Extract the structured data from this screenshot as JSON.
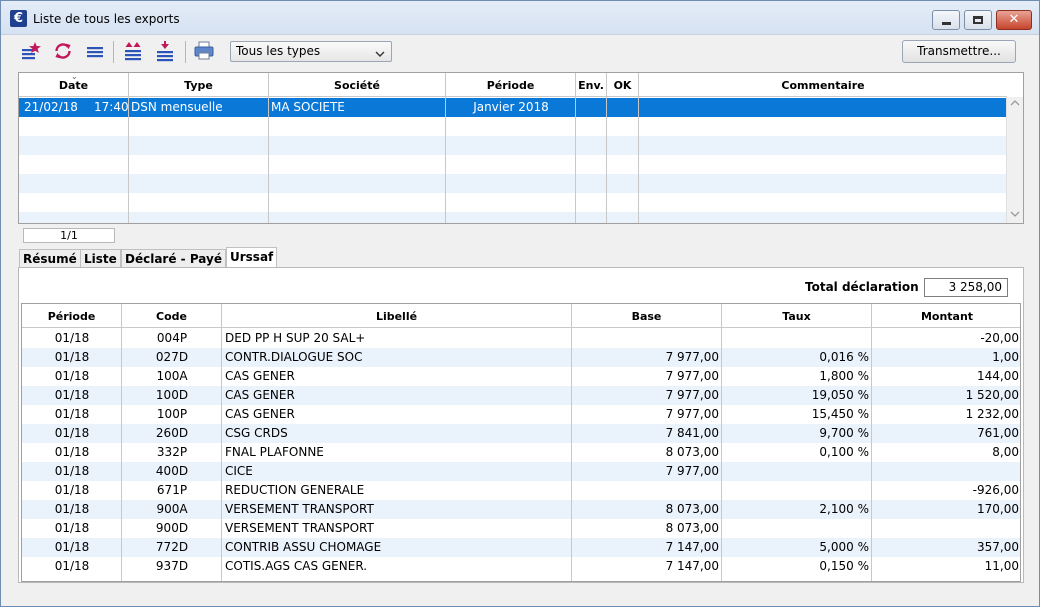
{
  "window": {
    "title": "Liste de tous les exports",
    "close_glyph": "✕"
  },
  "toolbar": {
    "icons": [
      "new-star-list-icon",
      "refresh-icon",
      "list-icon",
      "import-up-icon",
      "export-down-icon",
      "printer-icon"
    ],
    "type_filter": {
      "selected": "Tous les types"
    },
    "transmit_label": "Transmettre..."
  },
  "exports_grid": {
    "columns": [
      "Date",
      "Type",
      "Société",
      "Période",
      "Env.",
      "OK",
      "Commentaire"
    ],
    "rows": [
      {
        "date": "21/02/18",
        "time": "17:40",
        "type": "DSN mensuelle",
        "societe": "MA SOCIETE",
        "periode": "Janvier 2018",
        "env": "",
        "ok": "",
        "commentaire": ""
      }
    ],
    "pager": "1/1"
  },
  "tabs": [
    "Résumé",
    "Liste",
    "Déclaré - Payé",
    "Urssaf"
  ],
  "active_tab": "Urssaf",
  "urssaf": {
    "total_label": "Total déclaration",
    "total_value": "3 258,00",
    "columns": [
      "Période",
      "Code",
      "Libellé",
      "Base",
      "Taux",
      "Montant"
    ],
    "rows": [
      {
        "periode": "01/18",
        "code": "004P",
        "libelle": "DED PP H SUP 20 SAL+",
        "base": "",
        "taux": "",
        "montant": "-20,00"
      },
      {
        "periode": "01/18",
        "code": "027D",
        "libelle": "CONTR.DIALOGUE SOC",
        "base": "7 977,00",
        "taux": "0,016 %",
        "montant": "1,00"
      },
      {
        "periode": "01/18",
        "code": "100A",
        "libelle": "CAS GENER",
        "base": "7 977,00",
        "taux": "1,800 %",
        "montant": "144,00"
      },
      {
        "periode": "01/18",
        "code": "100D",
        "libelle": "CAS GENER",
        "base": "7 977,00",
        "taux": "19,050 %",
        "montant": "1 520,00"
      },
      {
        "periode": "01/18",
        "code": "100P",
        "libelle": "CAS GENER",
        "base": "7 977,00",
        "taux": "15,450 %",
        "montant": "1 232,00"
      },
      {
        "periode": "01/18",
        "code": "260D",
        "libelle": "CSG CRDS",
        "base": "7 841,00",
        "taux": "9,700 %",
        "montant": "761,00"
      },
      {
        "periode": "01/18",
        "code": "332P",
        "libelle": "FNAL PLAFONNE",
        "base": "8 073,00",
        "taux": "0,100 %",
        "montant": "8,00"
      },
      {
        "periode": "01/18",
        "code": "400D",
        "libelle": "CICE",
        "base": "7 977,00",
        "taux": "",
        "montant": ""
      },
      {
        "periode": "01/18",
        "code": "671P",
        "libelle": "REDUCTION GENERALE",
        "base": "",
        "taux": "",
        "montant": "-926,00"
      },
      {
        "periode": "01/18",
        "code": "900A",
        "libelle": "VERSEMENT TRANSPORT",
        "base": "8 073,00",
        "taux": "2,100 %",
        "montant": "170,00"
      },
      {
        "periode": "01/18",
        "code": "900D",
        "libelle": "VERSEMENT TRANSPORT",
        "base": "8 073,00",
        "taux": "",
        "montant": ""
      },
      {
        "periode": "01/18",
        "code": "772D",
        "libelle": "CONTRIB ASSU CHOMAGE",
        "base": "7 147,00",
        "taux": "5,000 %",
        "montant": "357,00"
      },
      {
        "periode": "01/18",
        "code": "937D",
        "libelle": "COTIS.AGS CAS GENER.",
        "base": "7 147,00",
        "taux": "0,150 %",
        "montant": "11,00"
      }
    ]
  },
  "colors": {
    "selection": "#0a78d7",
    "alt_row": "#eaf2fc",
    "accent_pink": "#c2185b",
    "accent_blue": "#2d54b8"
  }
}
